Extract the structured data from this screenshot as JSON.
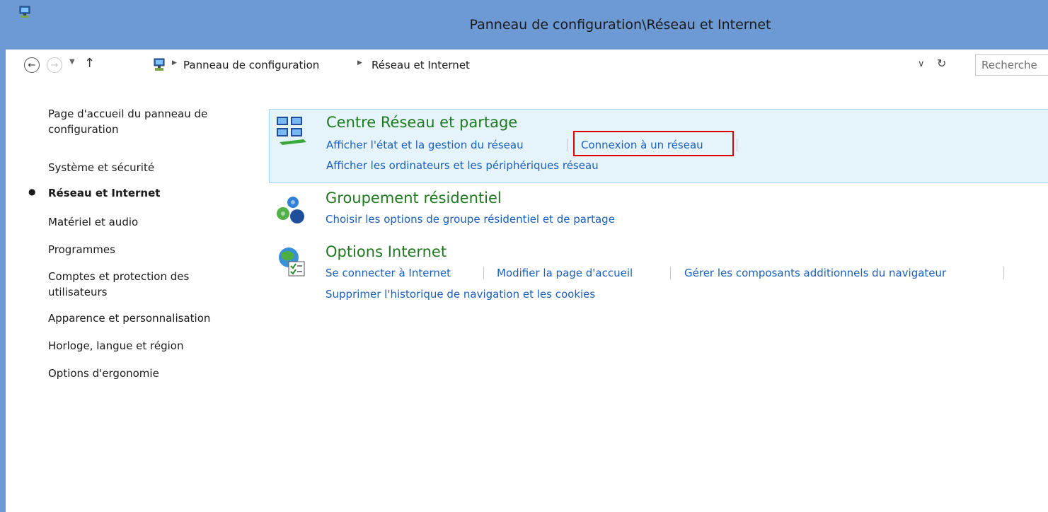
{
  "window": {
    "title": "Panneau de configuration\\Réseau et Internet"
  },
  "address": {
    "crumbs": [
      "Panneau de configuration",
      "Réseau et Internet"
    ],
    "search_placeholder": "Recherche"
  },
  "sidebar": {
    "items": [
      {
        "label": "Page d'accueil du panneau de configuration",
        "active": false
      },
      {
        "label": "Système et sécurité",
        "active": false
      },
      {
        "label": "Réseau et Internet",
        "active": true
      },
      {
        "label": "Matériel et audio",
        "active": false
      },
      {
        "label": "Programmes",
        "active": false
      },
      {
        "label": "Comptes et protection des utilisateurs",
        "active": false
      },
      {
        "label": "Apparence et personnalisation",
        "active": false
      },
      {
        "label": "Horloge, langue et région",
        "active": false
      },
      {
        "label": "Options d'ergonomie",
        "active": false
      }
    ]
  },
  "categories": [
    {
      "title": "Centre Réseau et partage",
      "icon": "network-sharing-icon",
      "links": [
        "Afficher l'état et la gestion du réseau",
        "Connexion à un réseau",
        "Afficher les ordinateurs et les périphériques réseau"
      ]
    },
    {
      "title": "Groupement résidentiel",
      "icon": "homegroup-icon",
      "links": [
        "Choisir les options de groupe résidentiel et de partage"
      ]
    },
    {
      "title": "Options Internet",
      "icon": "internet-options-icon",
      "links": [
        "Se connecter à Internet",
        "Modifier la page d'accueil",
        "Gérer les composants additionnels du navigateur",
        "Supprimer l'historique de navigation et les cookies"
      ]
    }
  ],
  "colors": {
    "titlebar": "#6d9ad4",
    "category_title": "#1e7a1e",
    "link": "#1a5fbb",
    "hover_bg": "#e5f3fb",
    "highlight": "#e00000"
  }
}
